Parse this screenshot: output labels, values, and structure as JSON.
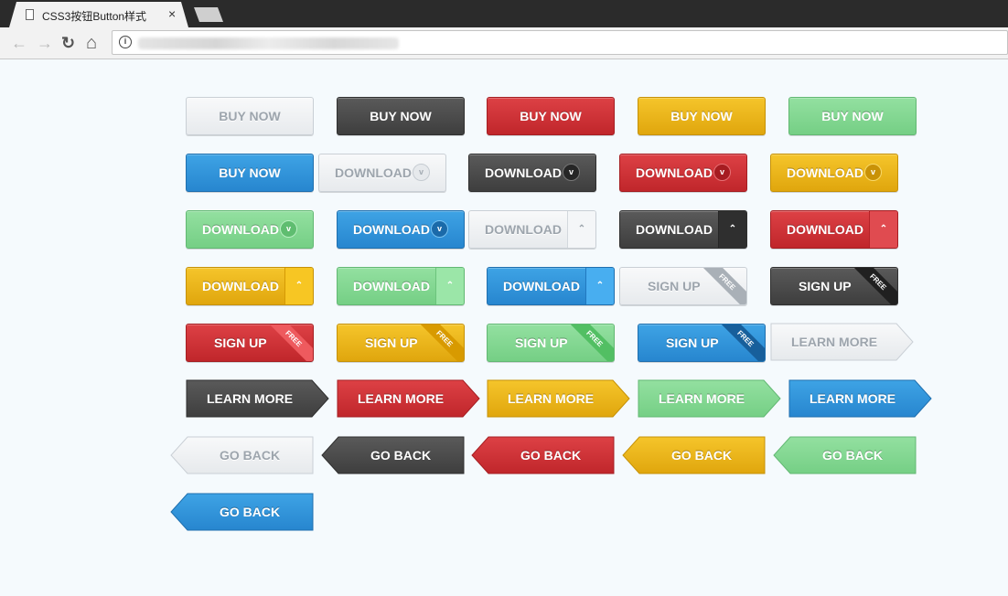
{
  "browser": {
    "tab_title": "CSS3按钮Button样式",
    "close_glyph": "×",
    "back_glyph": "←",
    "forward_glyph": "→",
    "reload_glyph": "↻",
    "home_glyph": "⌂",
    "info_glyph": "i"
  },
  "labels": {
    "buy_now": "BUY NOW",
    "download": "DOWNLOAD",
    "sign_up": "SIGN UP",
    "learn_more": "LEARN MORE",
    "go_back": "GO BACK",
    "free": "FREE",
    "circle_icon": "v",
    "chevron_up_icon": "⌃"
  },
  "colors": {
    "white": "#eef1f3",
    "dark": "#4a4a4a",
    "red": "#cf3236",
    "yellow": "#ecb617",
    "green": "#85d893",
    "blue": "#3194da",
    "page_background": "#f5fafd"
  },
  "icons": {
    "tab": "page-icon",
    "download_circle": "chevron-down-circle-icon",
    "download_segment": "double-chevron-up-icon",
    "ribbon": "free-ribbon"
  }
}
